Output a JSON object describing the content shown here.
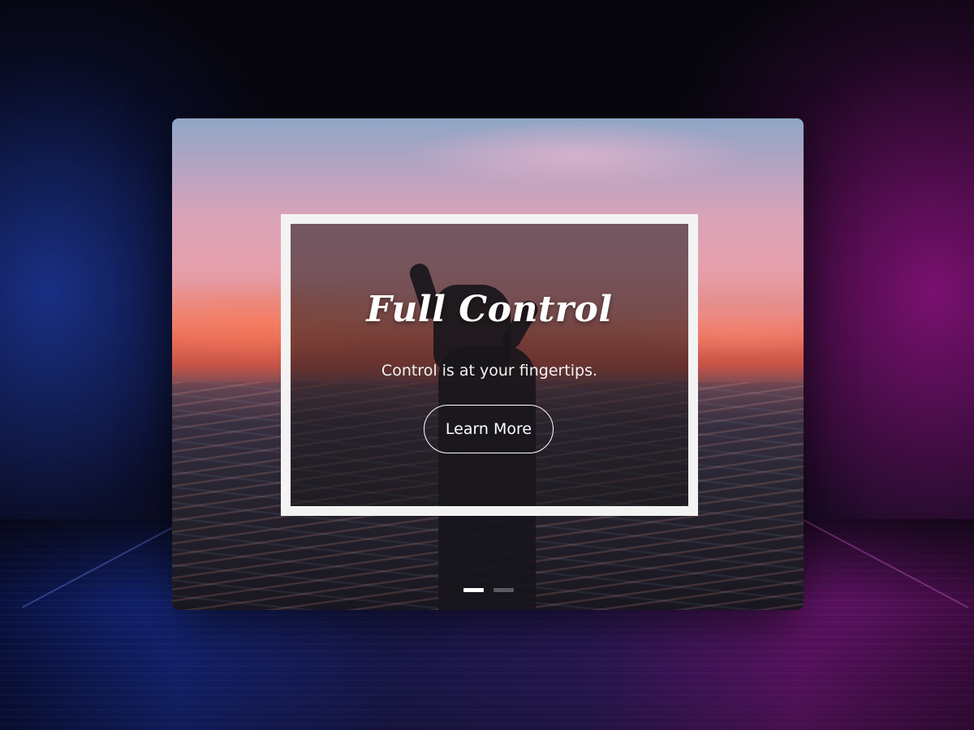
{
  "slider": {
    "slide": {
      "title": "Full Control",
      "text": "Control is at your fingertips.",
      "button_label": "Learn More"
    },
    "pagination": {
      "total": 2,
      "active_index": 0
    }
  },
  "colors": {
    "frame_border": "#f3f3f3",
    "text": "#ffffff",
    "dot_active": "#ffffff",
    "dot_inactive": "#5c5a60"
  }
}
